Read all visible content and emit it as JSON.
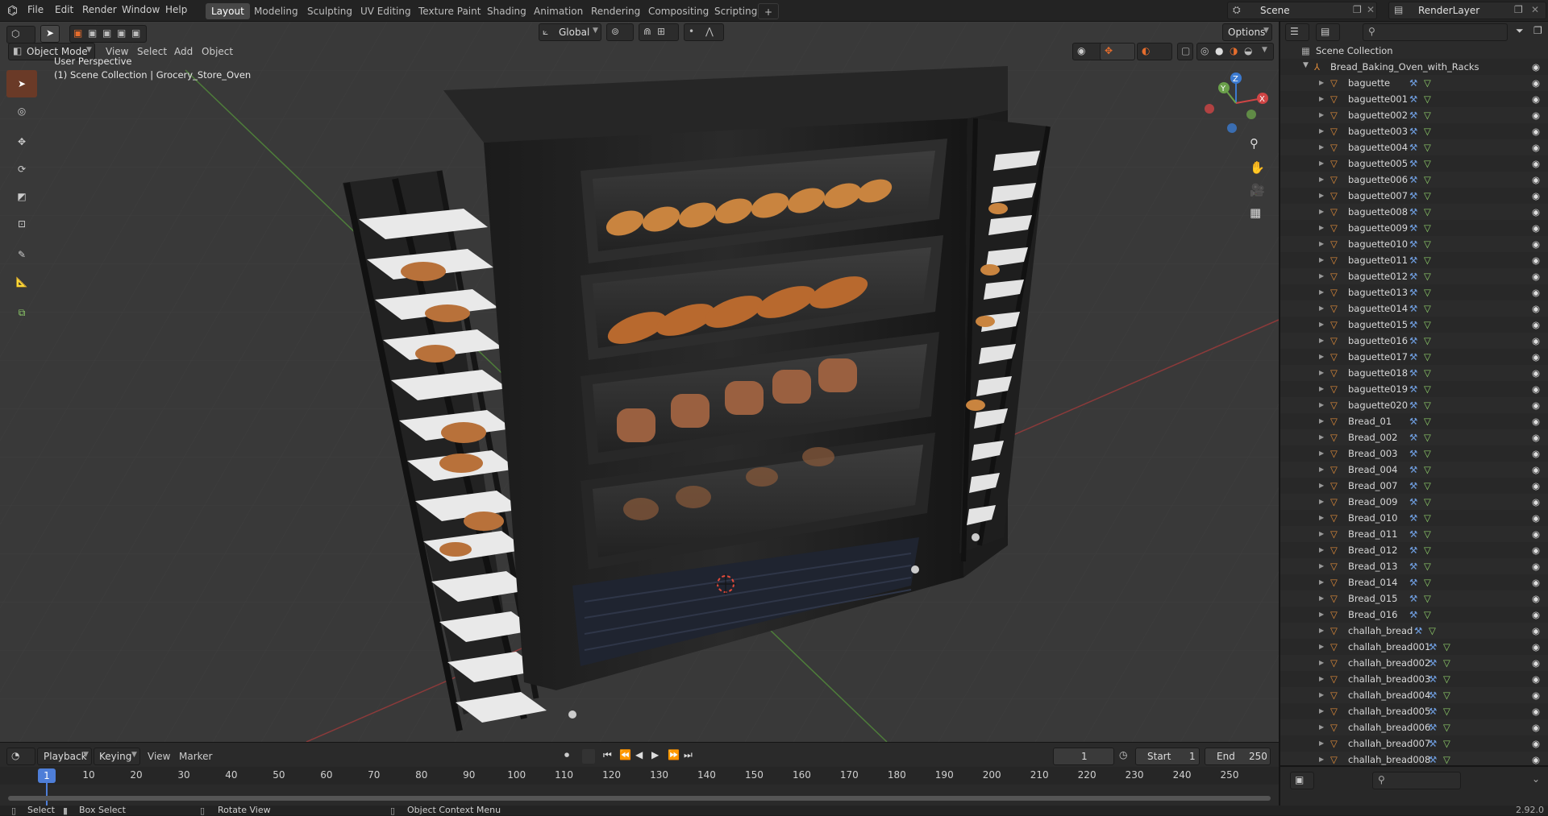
{
  "menu": [
    "File",
    "Edit",
    "Render",
    "Window",
    "Help"
  ],
  "workspaces": [
    {
      "label": "Layout",
      "active": true
    },
    {
      "label": "Modeling"
    },
    {
      "label": "Sculpting"
    },
    {
      "label": "UV Editing"
    },
    {
      "label": "Texture Paint"
    },
    {
      "label": "Shading"
    },
    {
      "label": "Animation"
    },
    {
      "label": "Rendering"
    },
    {
      "label": "Compositing"
    },
    {
      "label": "Scripting"
    }
  ],
  "scene_name": "Scene",
  "render_layer": "RenderLayer",
  "viewport_header": {
    "mode": "Object Mode",
    "menus": [
      "View",
      "Select",
      "Add",
      "Object"
    ],
    "transform": "Global",
    "options": "Options"
  },
  "viewport_overlay": {
    "perspective": "User Perspective",
    "collection": "(1) Scene Collection | Grocery_Store_Oven"
  },
  "gizmo": {
    "z": "Z",
    "y": "Y",
    "x": "X"
  },
  "outliner": {
    "root": "Scene Collection",
    "collection": "Bread_Baking_Oven_with_Racks",
    "items": [
      "baguette",
      "baguette001",
      "baguette002",
      "baguette003",
      "baguette004",
      "baguette005",
      "baguette006",
      "baguette007",
      "baguette008",
      "baguette009",
      "baguette010",
      "baguette011",
      "baguette012",
      "baguette013",
      "baguette014",
      "baguette015",
      "baguette016",
      "baguette017",
      "baguette018",
      "baguette019",
      "baguette020",
      "Bread_01",
      "Bread_002",
      "Bread_003",
      "Bread_004",
      "Bread_007",
      "Bread_009",
      "Bread_010",
      "Bread_011",
      "Bread_012",
      "Bread_013",
      "Bread_014",
      "Bread_015",
      "Bread_016",
      "challah_bread",
      "challah_bread001",
      "challah_bread002",
      "challah_bread003",
      "challah_bread004",
      "challah_bread005",
      "challah_bread006",
      "challah_bread007",
      "challah_bread008"
    ]
  },
  "timeline": {
    "menus": [
      "Playback",
      "Keying",
      "View",
      "Marker"
    ],
    "current_frame": "1",
    "start_label": "Start",
    "start": "1",
    "end_label": "End",
    "end": "250",
    "ticks": [
      "1",
      "10",
      "20",
      "30",
      "40",
      "50",
      "60",
      "70",
      "80",
      "90",
      "100",
      "110",
      "120",
      "130",
      "140",
      "150",
      "160",
      "170",
      "180",
      "190",
      "200",
      "210",
      "220",
      "230",
      "240",
      "250"
    ]
  },
  "statusbar": {
    "select": "Select",
    "box_select": "Box Select",
    "rotate_view": "Rotate View",
    "context_menu": "Object Context Menu",
    "version": "2.92.0"
  },
  "colors": {
    "accent": "#e56d2d",
    "active_tab": "#474747",
    "bg": "#393939"
  }
}
